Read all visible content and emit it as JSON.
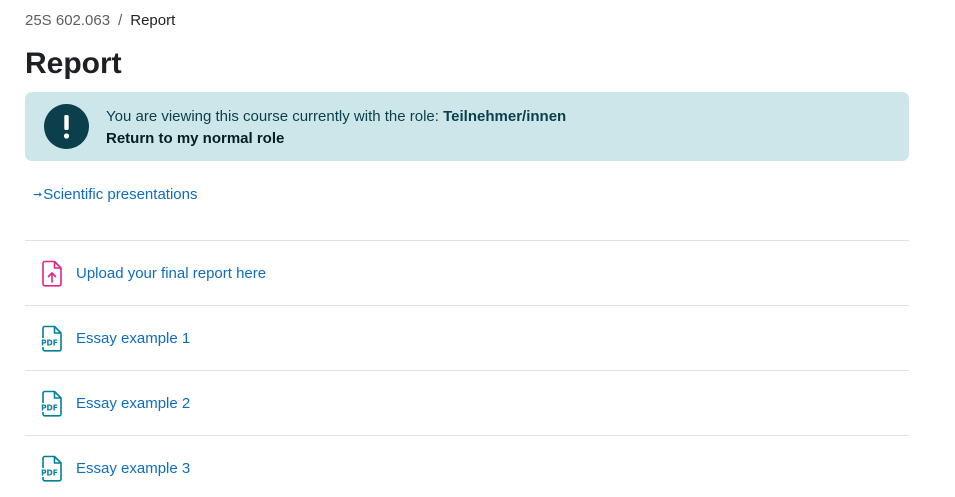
{
  "breadcrumb": {
    "course": "25S 602.063",
    "separator": "/",
    "current": "Report"
  },
  "page": {
    "title": "Report"
  },
  "alert": {
    "icon": "exclamation-icon",
    "message_prefix": "You are viewing this course currently with the role: ",
    "role": "Teilnehmer/innen",
    "return_link": "Return to my normal role",
    "colors": {
      "background": "#cce6ea",
      "icon_bg": "#0b3f4b",
      "text": "#0b3f4b"
    }
  },
  "section": {
    "arrow": "➞",
    "link": "Scientific presentations"
  },
  "activities": [
    {
      "icon": "assignment-upload-icon",
      "name": "Upload your final report here",
      "icon_color": "#e0248a"
    },
    {
      "icon": "pdf-file-icon",
      "name": "Essay example 1",
      "icon_color": "#008196"
    },
    {
      "icon": "pdf-file-icon",
      "name": "Essay example 2",
      "icon_color": "#008196"
    },
    {
      "icon": "pdf-file-icon",
      "name": "Essay example 3",
      "icon_color": "#008196"
    }
  ],
  "colors": {
    "link": "#0f6cbf",
    "divider": "#dee2e6"
  }
}
